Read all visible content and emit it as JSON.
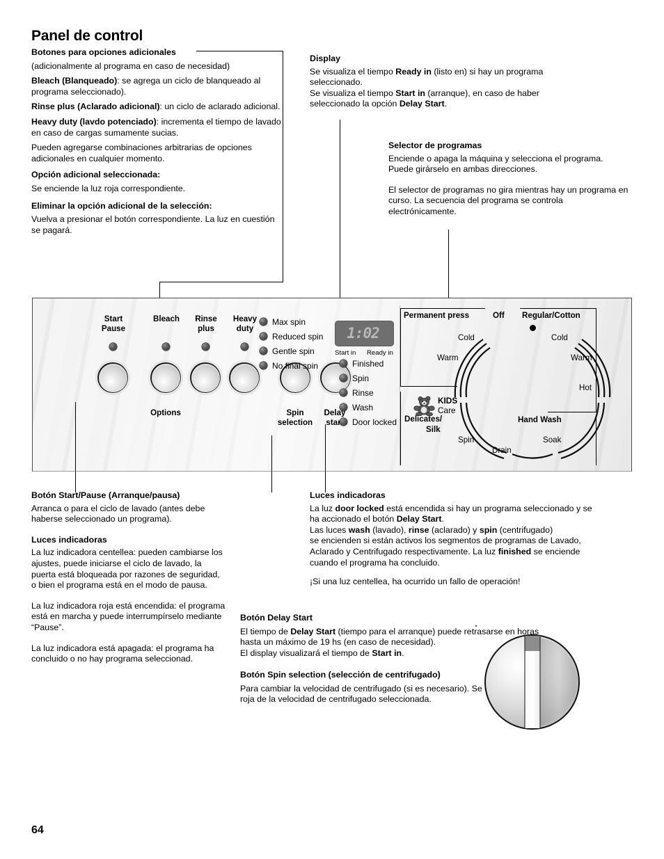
{
  "page": {
    "title": "Panel de control",
    "number": "64"
  },
  "callouts": {
    "options_buttons": {
      "heading": "Botones para opciones adicionales",
      "sub": "(adicionalmente al programa en caso de necesidad)",
      "bleach_label": "Bleach (Blanqueado)",
      "bleach_text": ": se agrega un ciclo de blanqueado al programa seleccionado).",
      "rinse_label": "Rinse plus (Aclarado adicional)",
      "rinse_text": ": un ciclo de aclarado adicional.",
      "heavy_label": "Heavy duty (lavdo potenciado)",
      "heavy_text": ": incrementa el tiempo de lavado en caso de cargas sumamente sucias.",
      "combos": "Pueden agregarse combinaciones arbitrarias de opciones adicionales en cualquier momento.",
      "selected_heading": "Opción adicional seleccionada:",
      "selected_text": "Se enciende la luz roja correspondiente.",
      "remove_heading": "Eliminar la opción adicional de la selección:",
      "remove_text": "Vuelva a presionar el botón correspondiente. La luz en cuestión se pagará."
    },
    "display": {
      "heading": "Display",
      "l1a": "Se visualiza el tiempo ",
      "l1b": "Ready in",
      "l1c": " (listo en) si hay un programa seleccionado.",
      "l2a": "Se visualiza el tiempo ",
      "l2b": "Start in",
      "l2c": " (arranque), en caso de haber seleccionado la opción ",
      "l2d": "Delay Start",
      "l2e": "."
    },
    "selector": {
      "heading": "Selector de programas",
      "p1": "Enciende o apaga la máquina y selecciona el programa. Puede girárselo en ambas direcciones.",
      "p2": "El selector de programas no gira mientras hay un programa en curso. La secuencia del programa se controla electrónicamente."
    },
    "start_pause": {
      "heading": "Botón Start/Pause (Arranque/pausa)",
      "text": "Arranca o para el ciclo de lavado (antes debe haberse seleccionado un programa).",
      "lights_heading": "Luces indicadoras",
      "p1": "La luz indicadora centellea: pueden cambiarse los ajustes, puede iniciarse el ciclo de lavado, la puerta está bloqueada por razones de seguridad, o bien el programa está en el modo de pausa.",
      "p2": "La luz indicadora roja está encendida: el programa está en marcha y puede interrumpírselo mediante “Pause”.",
      "p3": "La luz indicadora está apagada: el programa ha concluido o no hay programa seleccionad."
    },
    "indicator_lights": {
      "heading": "Luces indicadoras",
      "l1a": "La luz ",
      "l1b": "door locked",
      "l1c": " está encendida si hay un programa seleccionado y se ha accionado el botón ",
      "l1d": "Delay Start",
      "l1e": ".",
      "l2a": "Las luces ",
      "l2b": "wash",
      "l2c": " (lavado), ",
      "l2d": "rinse",
      "l2e": " (aclarado) y ",
      "l2f": "spin",
      "l2g": " (centrifugado)",
      "l3a": "se encienden si están activos los segmentos de programas de Lavado, Aclarado y Centrifugado respectivamente. La luz ",
      "l3b": "finished",
      "l3c": " se enciende cuando el programa ha concluido.",
      "warning": "¡Si una luz centellea, ha ocurrido un fallo de operación!"
    },
    "delay_start": {
      "heading": "Botón Delay Start",
      "l1a": "El tiempo de ",
      "l1b": "Delay Start",
      "l1c": " (tiempo para el arranque) puede retrasarse en horas hasta un máximo de 19 hs (en caso de necesidad).",
      "l2a": "El display visualizará el tiempo de ",
      "l2b": "Start in",
      "l2c": "."
    },
    "spin_selection": {
      "heading": "Botón Spin selection (selección de centrifugado)",
      "text": "Para cambiar la velocidad de centrifugado (si es necesario). Se enciende la luz roja de la velocidad de centrifugado seleccionada."
    }
  },
  "panel": {
    "buttons": [
      {
        "name": "start-pause",
        "line1": "Start",
        "line2": "Pause"
      },
      {
        "name": "bleach",
        "line1": "Bleach",
        "line2": ""
      },
      {
        "name": "rinse-plus",
        "line1": "Rinse",
        "line2": "plus"
      },
      {
        "name": "heavy-duty",
        "line1": "Heavy",
        "line2": "duty"
      },
      {
        "name": "spin-selection",
        "line1": "Spin",
        "line2": "selection"
      },
      {
        "name": "delay-start",
        "line1": "Delay",
        "line2": "start"
      }
    ],
    "options_group_label": "Options",
    "spin_options": [
      "Max spin",
      "Reduced spin",
      "Gentle spin",
      "No final spin"
    ],
    "display": {
      "value": "1:02",
      "cap_left": "Start in",
      "cap_right": "Ready in"
    },
    "status_lights": [
      "Finished",
      "Spin",
      "Rinse",
      "Wash",
      "Door locked"
    ],
    "dial": {
      "off": "Off",
      "group_permanent_press": "Permanent press",
      "group_regular_cotton": "Regular/Cotton",
      "group_hand_wash": "Hand Wash",
      "group_delicates_silk": "Delicates/ Silk",
      "delicates_line1": "Delicates/",
      "delicates_line2": "Silk",
      "kids_line1": "KIDS",
      "kids_line2": "Care",
      "left_cold": "Cold",
      "left_warm": "Warm",
      "right_cold": "Cold",
      "right_warm": "Warm",
      "right_hot": "Hot",
      "spin": "Spin",
      "drain": "Drain",
      "soak": "Soak"
    }
  },
  "colors": {
    "panel_bg": "#f2f2f2",
    "led_dark": "#3a3a3a",
    "lcd_bg": "#6f6f6f",
    "lcd_text": "#b8b8b8",
    "line": "#000000"
  }
}
